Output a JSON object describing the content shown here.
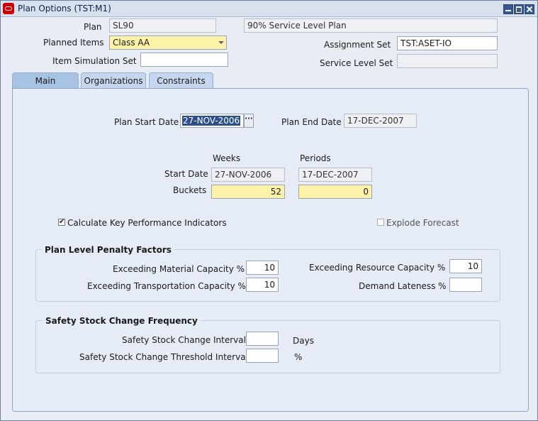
{
  "window": {
    "title": "Plan Options (TST:M1)"
  },
  "header": {
    "plan_label": "Plan",
    "plan_value": "SL90",
    "plan_desc": "90% Service Level Plan",
    "planned_items_label": "Planned Items",
    "planned_items_value": "Class AA",
    "assignment_set_label": "Assignment Set",
    "assignment_set_value": "TST:ASET-IO",
    "item_sim_set_label": "Item Simulation Set",
    "item_sim_set_value": "",
    "service_level_set_label": "Service Level Set",
    "service_level_set_value": ""
  },
  "tabs": [
    {
      "label": "Main"
    },
    {
      "label": "Organizations"
    },
    {
      "label": "Constraints"
    }
  ],
  "main": {
    "plan_start_label": "Plan Start Date",
    "plan_start_value": "27-NOV-2006",
    "plan_end_label": "Plan End Date",
    "plan_end_value": "17-DEC-2007",
    "weeks_label": "Weeks",
    "periods_label": "Periods",
    "start_date_label": "Start Date",
    "weeks_start": "27-NOV-2006",
    "periods_start": "17-DEC-2007",
    "buckets_label": "Buckets",
    "weeks_buckets": "52",
    "periods_buckets": "0",
    "kpi_label": "Calculate Key Performance Indicators",
    "explode_label": "Explode Forecast",
    "penalty": {
      "title": "Plan Level Penalty Factors",
      "material_label": "Exceeding Material Capacity %",
      "material_value": "10",
      "transport_label": "Exceeding Transportation Capacity %",
      "transport_value": "10",
      "resource_label": "Exceeding Resource Capacity %",
      "resource_value": "10",
      "lateness_label": "Demand Lateness %",
      "lateness_value": ""
    },
    "safety": {
      "title": "Safety Stock Change Frequency",
      "interval_label": "Safety Stock Change Interval",
      "interval_value": "",
      "interval_unit": "Days",
      "threshold_label": "Safety Stock Change Threshold Interval",
      "threshold_value": "",
      "threshold_unit": "%"
    }
  }
}
